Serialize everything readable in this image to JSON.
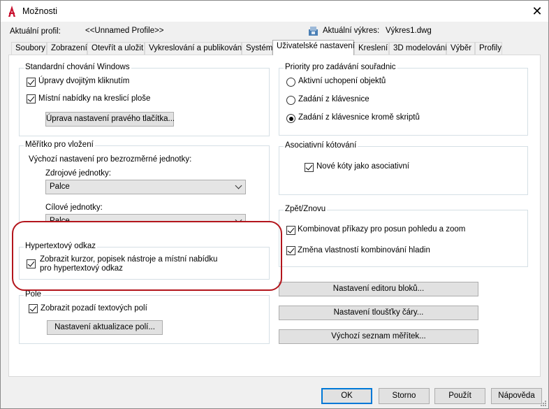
{
  "window": {
    "title": "Možnosti",
    "close_glyph": "✕"
  },
  "header": {
    "profile_label": "Aktuální profil:",
    "profile_value": "<<Unnamed Profile>>",
    "drawing_label": "Aktuální výkres:",
    "drawing_value": "Výkres1.dwg"
  },
  "tabs": [
    "Soubory",
    "Zobrazení",
    "Otevřít a uložit",
    "Vykreslování a publikování",
    "Systém",
    "Uživatelské nastavení",
    "Kreslení",
    "3D modelování",
    "Výběr",
    "Profily"
  ],
  "active_tab": "Uživatelské nastavení",
  "windows_behavior": {
    "title": "Standardní chování Windows",
    "dbl_click": "Úpravy dvojitým kliknutím",
    "context_menu": "Místní nabídky na kreslicí ploše",
    "right_click_button": "Úprava nastavení pravého tlačítka..."
  },
  "insert_scale": {
    "title": "Měřítko pro vložení",
    "default_label": "Výchozí nastavení pro bezrozměrné jednotky:",
    "source_label": "Zdrojové jednotky:",
    "source_value": "Palce",
    "target_label": "Cílové jednotky:",
    "target_value": "Palce"
  },
  "hyperlink": {
    "title": "Hypertextový odkaz",
    "line1": "Zobrazit kurzor, popisek nástroje a místní nabídku",
    "line2": "pro hypertextový odkaz"
  },
  "fields": {
    "title": "Pole",
    "background": "Zobrazit pozadí textových polí",
    "update_button": "Nastavení aktualizace polí..."
  },
  "coord_priority": {
    "title": "Priority pro zadávání souřadnic",
    "opt1": "Aktivní uchopení objektů",
    "opt2": "Zadání z klávesnice",
    "opt3": "Zadání z klávesnice kromě skriptů"
  },
  "assoc_dim": {
    "title": "Asociativní kótování",
    "new_assoc": "Nové kóty jako asociativní"
  },
  "undo_redo": {
    "title": "Zpět/Znovu",
    "combine_zoom": "Kombinovat příkazy pro posun pohledu a zoom",
    "combine_layers": "Změna vlastností kombinování hladin"
  },
  "right_buttons": {
    "block_editor": "Nastavení editoru bloků...",
    "lineweight": "Nastavení tloušťky čáry...",
    "scale_list": "Výchozí seznam měřítek..."
  },
  "footer": {
    "ok": "OK",
    "cancel": "Storno",
    "apply": "Použít",
    "help": "Nápověda"
  },
  "colors": {
    "highlight_ring": "#b3151c",
    "accent": "#0078d7",
    "app_icon": "#c8102e"
  }
}
